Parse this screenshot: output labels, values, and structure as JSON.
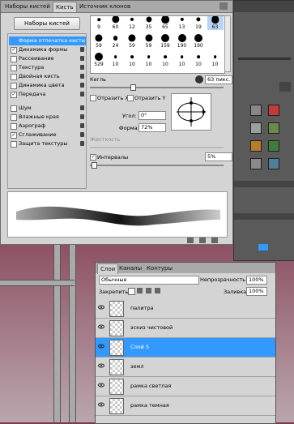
{
  "brush_panel": {
    "tabs": [
      "Наборы кистей",
      "Кисть",
      "Источник клонов"
    ],
    "presets_button": "Наборы кистей",
    "options": [
      {
        "label": "Форма отпечатка кисти",
        "checked": false,
        "selected": true,
        "locked": false
      },
      {
        "label": "Динамика формы",
        "checked": true,
        "selected": false,
        "locked": true
      },
      {
        "label": "Рассеивание",
        "checked": false,
        "selected": false,
        "locked": true
      },
      {
        "label": "Текстура",
        "checked": false,
        "selected": false,
        "locked": true
      },
      {
        "label": "Двойная кисть",
        "checked": false,
        "selected": false,
        "locked": true
      },
      {
        "label": "Динамика цвета",
        "checked": false,
        "selected": false,
        "locked": true
      },
      {
        "label": "Передача",
        "checked": true,
        "selected": false,
        "locked": true
      },
      {
        "label": "Шум",
        "checked": false,
        "selected": false,
        "locked": true
      },
      {
        "label": "Влажные края",
        "checked": false,
        "selected": false,
        "locked": true
      },
      {
        "label": "Аэрограф",
        "checked": false,
        "selected": false,
        "locked": true
      },
      {
        "label": "Сглаживание",
        "checked": true,
        "selected": false,
        "locked": true
      },
      {
        "label": "Защита текстуры",
        "checked": false,
        "selected": false,
        "locked": true
      }
    ],
    "brush_sizes": [
      [
        "9",
        "60",
        "12",
        "35",
        "65",
        "13",
        "19",
        "63"
      ],
      [
        "59",
        "24",
        "59",
        "59",
        "159",
        "190",
        "190",
        ""
      ],
      [
        "529",
        "10",
        "10",
        "10",
        "10",
        "10",
        "10",
        "10"
      ]
    ],
    "selected_brush": "63",
    "size_label": "Кегль",
    "size_value": "63 пикс.",
    "flip_x": "Отразить X",
    "flip_y": "Отразить Y",
    "angle_label": "Угол:",
    "angle_value": "0°",
    "roundness_label": "Форма:",
    "roundness_value": "72%",
    "hardness_label": "Жесткость",
    "spacing_label": "Интервалы",
    "spacing_checked": true,
    "spacing_value": "5%"
  },
  "layers_panel": {
    "tabs": [
      "Слои",
      "Каналы",
      "Контуры"
    ],
    "blend_mode": "Обычные",
    "opacity_label": "Непрозрачность:",
    "opacity_value": "100%",
    "lock_label": "Закрепить:",
    "fill_label": "Заливка:",
    "fill_value": "100%",
    "layers": [
      {
        "name": "палитра",
        "selected": false
      },
      {
        "name": "эскиз чистовой",
        "selected": false
      },
      {
        "name": "Слой 5",
        "selected": true
      },
      {
        "name": "земл",
        "selected": false
      },
      {
        "name": "рамка светлая",
        "selected": false
      },
      {
        "name": "рамка темная",
        "selected": false
      }
    ]
  },
  "colors": {
    "accent": "#3399ff",
    "panel": "#d4d4d4",
    "dark_panel": "#5a5a5a"
  }
}
